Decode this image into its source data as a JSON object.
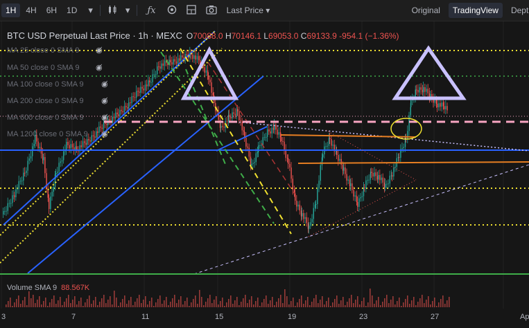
{
  "toolbar": {
    "timeframes": [
      "1H",
      "4H",
      "6H",
      "1D"
    ],
    "active_timeframe": "1H",
    "timeframe_dropdown": "▾",
    "price_type": "Last Price",
    "views": [
      "Original",
      "TradingView",
      "Depth"
    ],
    "active_view": "TradingView"
  },
  "legend": {
    "symbol": "BTC USD Perpetual Last Price · 1h · MEXC",
    "open_label": "O",
    "open": "70088.0",
    "high_label": "H",
    "high": "70146.1",
    "low_label": "L",
    "low": "69053.0",
    "close_label": "C",
    "close": "69133.9",
    "change": "-954.1 (−1.36%)"
  },
  "indicators": [
    "MA 25 close 0 SMA 9",
    "MA 50 close 0 SMA 9",
    "MA 100 close 0 SMA 9",
    "MA 200 close 0 SMA 9",
    "MA 600 close 0 SMA 9",
    "MA 1200 close 0 SMA 9"
  ],
  "volume": {
    "label": "Volume SMA 9",
    "value": "88.567K"
  },
  "xaxis": [
    "3",
    "7",
    "11",
    "15",
    "19",
    "23",
    "27",
    "Ap"
  ],
  "colors": {
    "bull": "#26a69a",
    "bear": "#ef5350",
    "yellow": "#f0e130",
    "blue": "#2962ff",
    "green": "#3fae49",
    "orange": "#e67e22",
    "pink": "#f8a5c2",
    "lavender": "#c9c1ff"
  }
}
